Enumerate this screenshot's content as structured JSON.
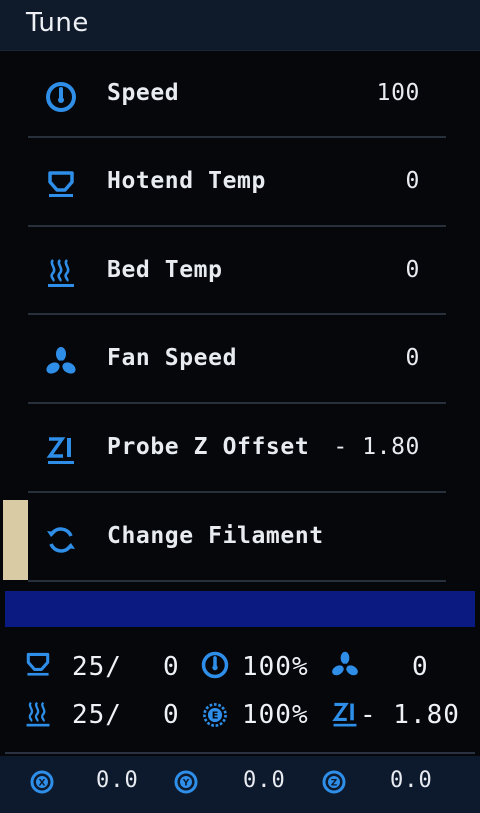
{
  "title": "Tune",
  "colors": {
    "accent": "#2e8ee8",
    "selection": "#d9cba4",
    "progress": "#0a1a80"
  },
  "menu": [
    {
      "icon": "speed-gauge-icon",
      "label": "Speed",
      "value": "100"
    },
    {
      "icon": "hotend-icon",
      "label": "Hotend Temp",
      "value": "0"
    },
    {
      "icon": "bed-heat-icon",
      "label": "Bed Temp",
      "value": "0"
    },
    {
      "icon": "fan-icon",
      "label": "Fan Speed",
      "value": "0"
    },
    {
      "icon": "probe-z-icon",
      "label": "Probe Z Offset",
      "value": "- 1.80"
    },
    {
      "icon": "change-filament-icon",
      "label": "Change Filament",
      "value": ""
    }
  ],
  "progress": {
    "fraction": 0
  },
  "status": {
    "hotend": {
      "current": "25/",
      "target": "0"
    },
    "speed": "100%",
    "fan": "0",
    "bed": {
      "current": "25/",
      "target": "0"
    },
    "flow": "100%",
    "z_offset": "- 1.80"
  },
  "axes": {
    "x": "0.0",
    "y": "0.0",
    "z": "0.0"
  }
}
